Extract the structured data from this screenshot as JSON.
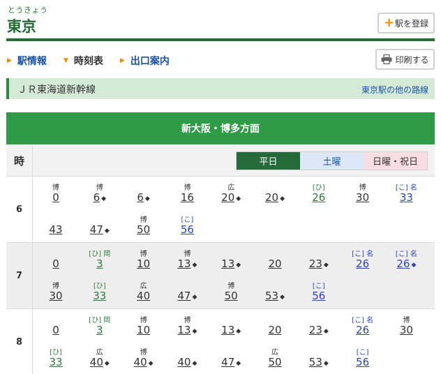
{
  "header": {
    "ruby": "とうきょう",
    "station": "東京",
    "register_label": "駅を登録"
  },
  "nav": {
    "items": [
      {
        "label": "駅情報",
        "current": false
      },
      {
        "label": "時刻表",
        "current": true
      },
      {
        "label": "出口案内",
        "current": false
      }
    ],
    "print_label": "印刷する"
  },
  "line": {
    "name": "ＪＲ東海道新幹線",
    "other_lines": "東京駅の他の路線"
  },
  "direction": "新大阪・博多方面",
  "table": {
    "hour_header": "時",
    "tabs": {
      "weekday": "平日",
      "saturday": "土曜",
      "holiday": "日曜・祝日"
    },
    "diamond_mark": "◆",
    "hours": [
      {
        "hour": "6",
        "trains": [
          {
            "anno": "博",
            "min": "0",
            "diamond": false,
            "type": "plain"
          },
          {
            "anno": "博",
            "min": "6",
            "diamond": true,
            "type": "plain"
          },
          {
            "anno": "",
            "min": "6",
            "diamond": true,
            "type": "plain"
          },
          {
            "anno": "博",
            "min": "16",
            "diamond": false,
            "type": "plain"
          },
          {
            "anno": "広",
            "min": "20",
            "diamond": true,
            "type": "plain"
          },
          {
            "anno": "",
            "min": "20",
            "diamond": true,
            "type": "plain"
          },
          {
            "anno": "[ひ]",
            "min": "26",
            "diamond": false,
            "type": "hi"
          },
          {
            "anno": "博",
            "min": "30",
            "diamond": false,
            "type": "plain"
          },
          {
            "anno": "[こ] 名",
            "min": "33",
            "diamond": false,
            "type": "ko"
          },
          {
            "anno": "",
            "min": "43",
            "diamond": false,
            "type": "plain"
          },
          {
            "anno": "",
            "min": "47",
            "diamond": true,
            "type": "plain"
          },
          {
            "anno": "博",
            "min": "50",
            "diamond": false,
            "type": "plain"
          },
          {
            "anno": "[こ]",
            "min": "56",
            "diamond": false,
            "type": "ko"
          }
        ]
      },
      {
        "hour": "7",
        "trains": [
          {
            "anno": "",
            "min": "0",
            "diamond": false,
            "type": "plain"
          },
          {
            "anno": "[ひ] 岡",
            "min": "3",
            "diamond": false,
            "type": "hi"
          },
          {
            "anno": "博",
            "min": "10",
            "diamond": false,
            "type": "plain"
          },
          {
            "anno": "博",
            "min": "13",
            "diamond": true,
            "type": "plain"
          },
          {
            "anno": "",
            "min": "13",
            "diamond": true,
            "type": "plain"
          },
          {
            "anno": "",
            "min": "20",
            "diamond": false,
            "type": "plain"
          },
          {
            "anno": "",
            "min": "23",
            "diamond": true,
            "type": "plain"
          },
          {
            "anno": "[こ] 名",
            "min": "26",
            "diamond": false,
            "type": "ko"
          },
          {
            "anno": "[こ] 名",
            "min": "26",
            "diamond": true,
            "type": "ko"
          },
          {
            "anno": "博",
            "min": "30",
            "diamond": false,
            "type": "plain"
          },
          {
            "anno": "[ひ]",
            "min": "33",
            "diamond": false,
            "type": "hi"
          },
          {
            "anno": "広",
            "min": "40",
            "diamond": false,
            "type": "plain"
          },
          {
            "anno": "",
            "min": "47",
            "diamond": true,
            "type": "plain"
          },
          {
            "anno": "博",
            "min": "50",
            "diamond": false,
            "type": "plain"
          },
          {
            "anno": "",
            "min": "53",
            "diamond": true,
            "type": "plain"
          },
          {
            "anno": "[こ]",
            "min": "56",
            "diamond": false,
            "type": "ko"
          }
        ]
      },
      {
        "hour": "8",
        "trains": [
          {
            "anno": "",
            "min": "0",
            "diamond": false,
            "type": "plain"
          },
          {
            "anno": "[ひ] 岡",
            "min": "3",
            "diamond": false,
            "type": "hi"
          },
          {
            "anno": "博",
            "min": "10",
            "diamond": false,
            "type": "plain"
          },
          {
            "anno": "博",
            "min": "13",
            "diamond": true,
            "type": "plain"
          },
          {
            "anno": "",
            "min": "13",
            "diamond": true,
            "type": "plain"
          },
          {
            "anno": "",
            "min": "20",
            "diamond": false,
            "type": "plain"
          },
          {
            "anno": "",
            "min": "23",
            "diamond": true,
            "type": "plain"
          },
          {
            "anno": "[こ] 名",
            "min": "26",
            "diamond": false,
            "type": "ko"
          },
          {
            "anno": "博",
            "min": "30",
            "diamond": false,
            "type": "plain"
          },
          {
            "anno": "[ひ]",
            "min": "33",
            "diamond": false,
            "type": "hi"
          },
          {
            "anno": "広",
            "min": "40",
            "diamond": true,
            "type": "plain"
          },
          {
            "anno": "博",
            "min": "40",
            "diamond": true,
            "type": "plain"
          },
          {
            "anno": "",
            "min": "40",
            "diamond": true,
            "type": "plain"
          },
          {
            "anno": "",
            "min": "47",
            "diamond": true,
            "type": "plain"
          },
          {
            "anno": "広",
            "min": "50",
            "diamond": false,
            "type": "plain"
          },
          {
            "anno": "",
            "min": "53",
            "diamond": true,
            "type": "plain"
          },
          {
            "anno": "[こ]",
            "min": "56",
            "diamond": false,
            "type": "ko"
          }
        ]
      }
    ]
  },
  "colors": {
    "brand_green": "#2a6c38",
    "header_green": "#2f9b47",
    "link_blue": "#1a55a8",
    "accent_orange": "#f08c00",
    "hikari_green": "#2b7a3b",
    "kodama_blue": "#2a44b8"
  },
  "icons": [
    "plus-icon",
    "arrow-right-icon",
    "arrow-down-icon",
    "printer-icon"
  ]
}
